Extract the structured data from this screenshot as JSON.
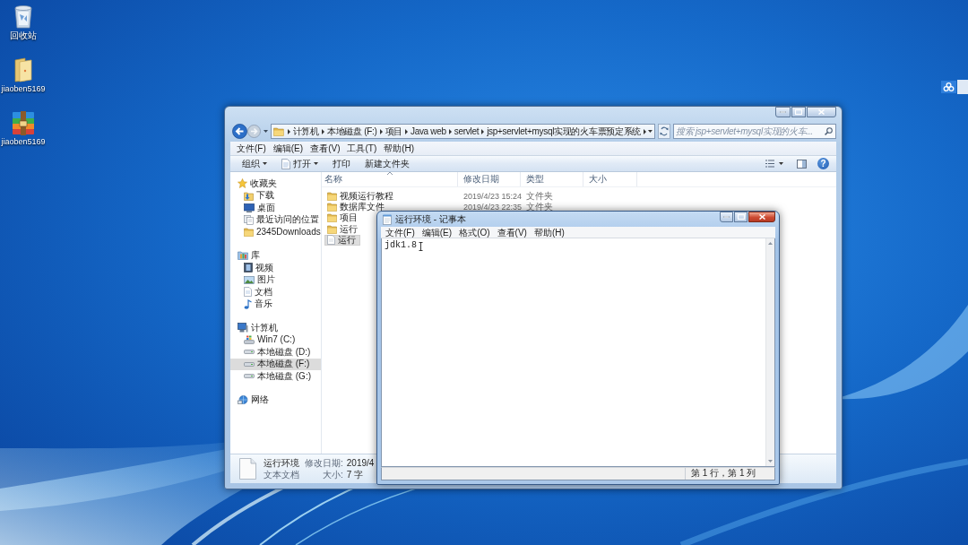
{
  "desktop": {
    "icons": [
      {
        "kind": "recycle_bin",
        "label": "回收站"
      },
      {
        "kind": "folder",
        "label": "jiaoben5169"
      },
      {
        "kind": "archive",
        "label": "jiaoben5169"
      }
    ]
  },
  "explorer": {
    "address": [
      "计算机",
      "本地磁盘 (F:)",
      "项目",
      "Java web",
      "servlet",
      "jsp+servlet+mysql实现的火车票预定系统"
    ],
    "search": {
      "placeholder": "搜索 jsp+servlet+mysql实现的火车..."
    },
    "menu": [
      "文件(F)",
      "编辑(E)",
      "查看(V)",
      "工具(T)",
      "帮助(H)"
    ],
    "toolbar": [
      {
        "label": "组织",
        "kind": "plain",
        "dropdown": true
      },
      {
        "label": "打开",
        "kind": "open",
        "dropdown": true
      },
      {
        "label": "打印",
        "kind": "plain",
        "dropdown": false
      },
      {
        "label": "新建文件夹",
        "kind": "plain",
        "dropdown": false
      }
    ],
    "help_button": "?",
    "sidebar": [
      {
        "label": "收藏夹",
        "kind": "favorites",
        "selected": false,
        "children": [
          {
            "label": "下载",
            "kind": "downloads",
            "selected": false
          },
          {
            "label": "桌面",
            "kind": "desktop",
            "selected": false
          },
          {
            "label": "最近访问的位置",
            "kind": "recent",
            "selected": false
          },
          {
            "label": "2345Downloads",
            "kind": "folder",
            "selected": false
          }
        ]
      },
      {
        "label": "库",
        "kind": "library",
        "selected": false,
        "children": [
          {
            "label": "视频",
            "kind": "video",
            "selected": false
          },
          {
            "label": "图片",
            "kind": "pictures",
            "selected": false
          },
          {
            "label": "文档",
            "kind": "documents",
            "selected": false
          },
          {
            "label": "音乐",
            "kind": "music",
            "selected": false
          }
        ]
      },
      {
        "label": "计算机",
        "kind": "computer",
        "selected": false,
        "children": [
          {
            "label": "Win7 (C:)",
            "kind": "system_drive",
            "selected": false
          },
          {
            "label": "本地磁盘 (D:)",
            "kind": "drive",
            "selected": false
          },
          {
            "label": "本地磁盘 (F:)",
            "kind": "drive",
            "selected": true
          },
          {
            "label": "本地磁盘 (G:)",
            "kind": "drive",
            "selected": false
          }
        ]
      },
      {
        "label": "网络",
        "kind": "network",
        "selected": false
      }
    ],
    "columns": [
      {
        "label": "名称",
        "sorted": true
      },
      {
        "label": "修改日期",
        "sorted": false
      },
      {
        "label": "类型",
        "sorted": false
      },
      {
        "label": "大小",
        "sorted": false
      }
    ],
    "files": [
      {
        "kind": "folder",
        "name": "视频运行教程",
        "modified": "2019/4/23 15:24",
        "type": "文件夹",
        "selected": false
      },
      {
        "kind": "folder",
        "name": "数据库文件",
        "modified": "2019/4/23 22:35",
        "type": "文件夹",
        "selected": false
      },
      {
        "kind": "folder",
        "name": "项目",
        "selected": false
      },
      {
        "kind": "folder",
        "name": "运行",
        "selected": false
      },
      {
        "kind": "text",
        "name": "运行",
        "selected": true
      }
    ],
    "details": {
      "name": "运行环境",
      "file_type": "文本文档",
      "modified_label": "修改日期:",
      "modified": "2019/4",
      "size_label": "大小:",
      "size": "7 字"
    }
  },
  "notepad": {
    "title": "运行环境 - 记事本",
    "menu": [
      "文件(F)",
      "编辑(E)",
      "格式(O)",
      "查看(V)",
      "帮助(H)"
    ],
    "text": "jdk1.8",
    "status": "第 1 行，第 1 列"
  }
}
